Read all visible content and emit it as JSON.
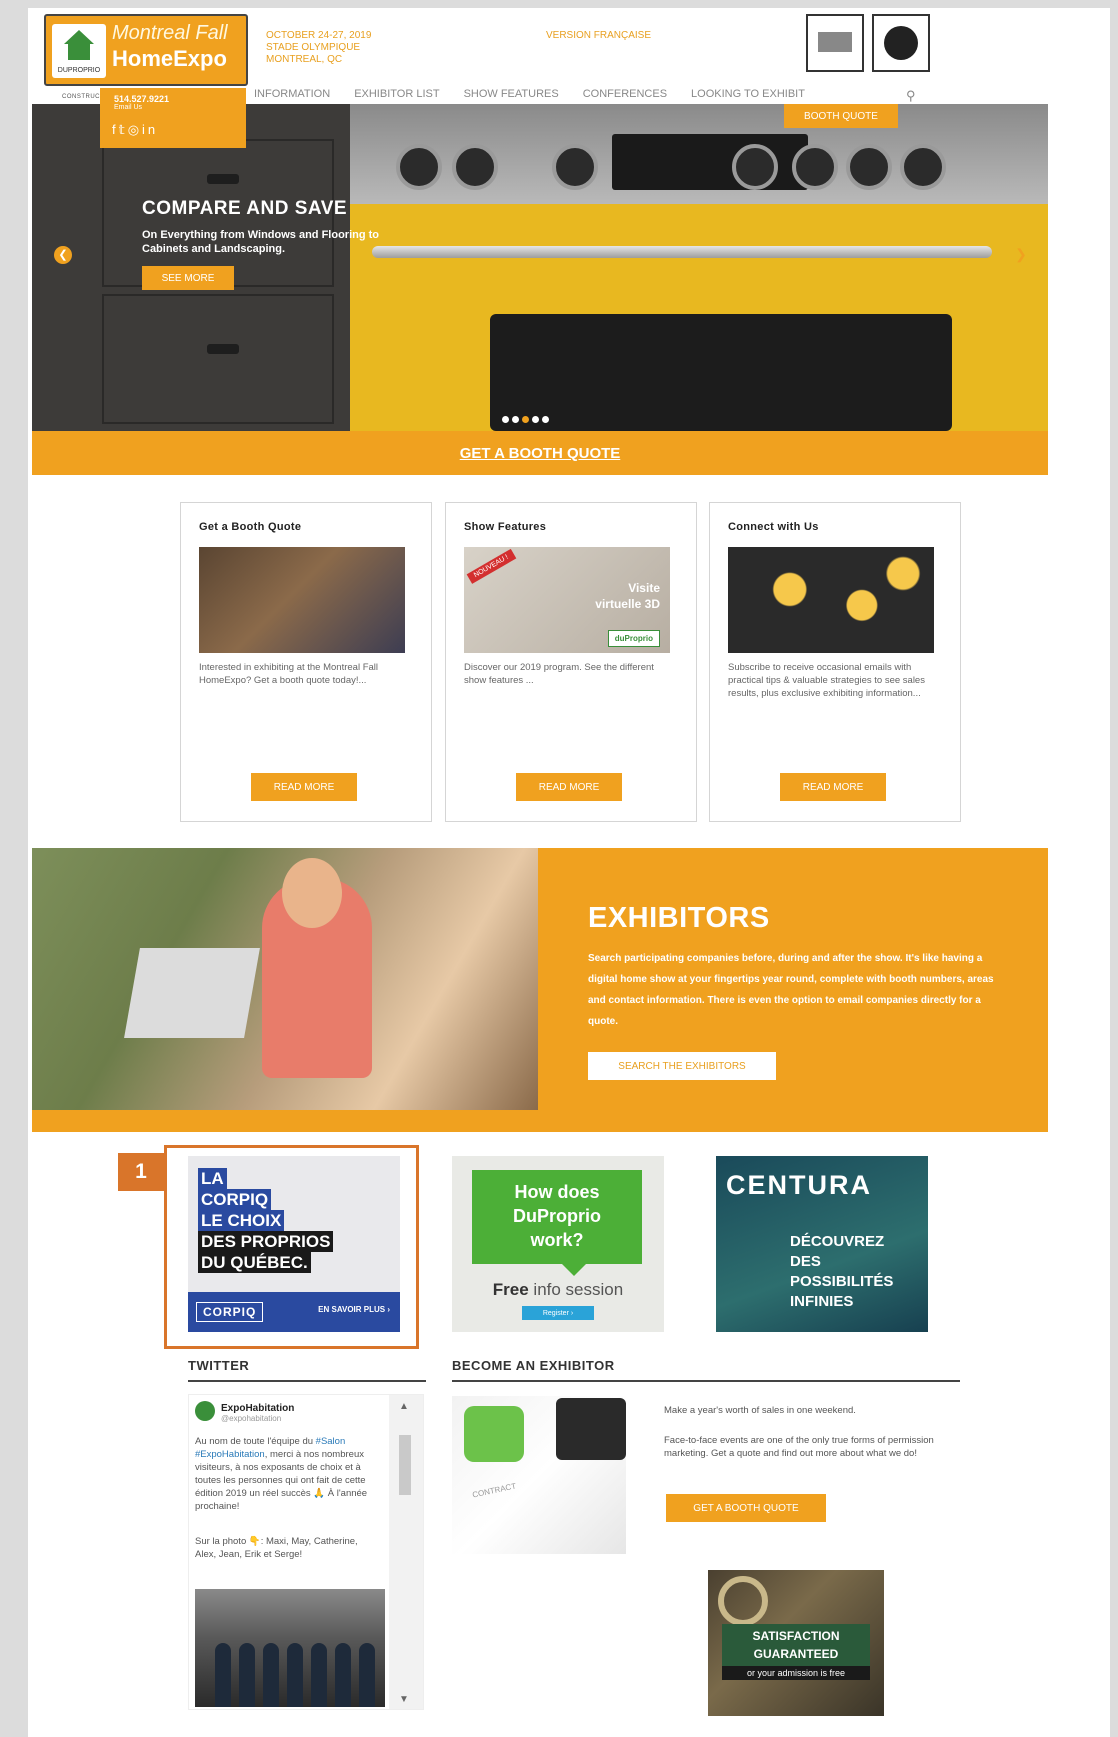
{
  "header": {
    "logo": {
      "brand": "DUPROPRIO",
      "title_line1": "Montreal Fall",
      "title_line2": "HomeExpo",
      "tagline": "CONSTRUCTION · RENOVATION · DESIGN"
    },
    "event": {
      "dates": "OCTOBER 24-27, 2019",
      "venue": "STADE OLYMPIQUE",
      "city": "MONTREAL, QC"
    },
    "version_link": "VERSION FRANÇAISE",
    "contact": {
      "phone": "514.527.9221",
      "email": "Email Us"
    },
    "socials": [
      "f",
      "t",
      "ig",
      "in"
    ]
  },
  "nav": {
    "items": [
      "INFORMATION",
      "EXHIBITOR LIST",
      "SHOW FEATURES",
      "CONFERENCES",
      "LOOKING TO EXHIBIT"
    ],
    "search_icon": "search-icon"
  },
  "hero": {
    "title": "COMPARE AND SAVE",
    "subtitle": "On Everything from Windows and Flooring to Cabinets and Landscaping.",
    "button": "SEE MORE",
    "booth_tab": "BOOTH QUOTE",
    "slide_count": 5,
    "active_slide": 3,
    "prev_icon": "chevron-left-icon",
    "next_icon": "chevron-right-icon"
  },
  "quote_band": {
    "label": "GET A BOOTH QUOTE"
  },
  "cards": [
    {
      "title": "Get a Booth Quote",
      "text": "Interested in exhibiting at the Montreal Fall HomeExpo? Get a booth quote today!...",
      "button": "READ MORE"
    },
    {
      "title": "Show Features",
      "text": "Discover our 2019 program. See the different show features ...",
      "button": "READ MORE",
      "ribbon": "NOUVEAU !",
      "overlay_line1": "Visite",
      "overlay_line2": "virtuelle 3D",
      "overlay_brand": "duProprio"
    },
    {
      "title": "Connect with Us",
      "text": "Subscribe to receive occasional emails with practical tips & valuable strategies to see sales results, plus exclusive exhibiting information...",
      "button": "READ MORE"
    }
  ],
  "exhibitors": {
    "title": "EXHIBITORS",
    "description": "Search participating companies before, during and after the show. It's like having a digital home show at your fingertips year round, complete with booth numbers, areas and contact information. There is even the option to email companies directly for a quote.",
    "button": "SEARCH THE EXHIBITORS"
  },
  "ads": {
    "badge": "1",
    "corpiq": {
      "lines": [
        "LA",
        "CORPIQ",
        "LE CHOIX",
        "DES PROPRIOS",
        "DU QUÉBEC."
      ],
      "brand": "CORPIQ",
      "more": "EN SAVOIR PLUS ›"
    },
    "duproprio": {
      "lines": [
        "How does",
        "DuProprio",
        "work?"
      ],
      "info_bold": "Free",
      "info_rest": " info session",
      "button": "Register ›"
    },
    "centura": {
      "brand": "CENTURA",
      "lines": [
        "DÉCOUVREZ",
        "DES",
        "POSSIBILITÉS",
        "INFINIES"
      ]
    }
  },
  "twitter": {
    "heading": "TWITTER",
    "name": "ExpoHabitation",
    "handle": "@expohabitation",
    "text_lead": "Au nom de toute l'équipe du ",
    "text_link": "#Salon #ExpoHabitation",
    "text_rest": ", merci à nos nombreux visiteurs, à nos exposants de choix et à toutes les personnes qui ont fait de cette édition 2019 un réel succès 🙏 À l'année prochaine!",
    "caption": "Sur la photo 👇: Maxi, May, Catherine, Alex, Jean, Erik et Serge!"
  },
  "become_exhibitor": {
    "heading": "BECOME AN EXHIBITOR",
    "text1": "Make a year's worth of sales in one weekend.",
    "text2": "Face-to-face events are one of the only true forms of permission marketing. Get a quote and find out more about what we do!",
    "button": "GET A BOOTH QUOTE",
    "paper_label": "CONTRACT"
  },
  "satisfaction": {
    "line1": "SATISFACTION",
    "line2": "GUARANTEED",
    "sub": "or your admission is free"
  },
  "colors": {
    "accent": "#f0a11f",
    "highlight": "#d9752a"
  }
}
